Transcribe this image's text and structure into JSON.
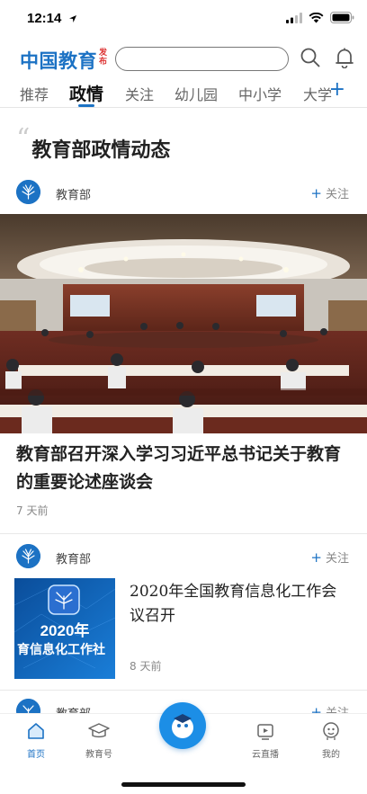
{
  "status_bar": {
    "time": "12:14"
  },
  "header": {
    "logo_text": "中国教育",
    "logo_sub": "发布",
    "search_placeholder": ""
  },
  "tabs": [
    "推荐",
    "政情",
    "关注",
    "幼儿园",
    "中小学",
    "大学"
  ],
  "active_tab": "政情",
  "section": {
    "title": "教育部政情动态"
  },
  "articles": [
    {
      "source": "教育部",
      "follow_label": "关注",
      "title": "教育部召开深入学习习近平总书记关于教育的重要论述座谈会",
      "time": "7 天前"
    },
    {
      "source": "教育部",
      "follow_label": "关注",
      "title": "2020年全国教育信息化工作会议召开",
      "time": "8 天前",
      "thumb_year": "2020年",
      "thumb_caption": "育信息化工作社"
    },
    {
      "source": "教育部",
      "follow_label": "关注"
    }
  ],
  "tab_bar": {
    "items": [
      {
        "label": "首页",
        "icon": "home-icon",
        "active": true
      },
      {
        "label": "教育号",
        "icon": "graduation-cap-icon",
        "active": false
      },
      {
        "label": "云直播",
        "icon": "video-play-icon",
        "active": false
      },
      {
        "label": "我的",
        "icon": "profile-icon",
        "active": false
      }
    ]
  },
  "colors": {
    "brand": "#1c72c4",
    "accent_red": "#d33333"
  }
}
